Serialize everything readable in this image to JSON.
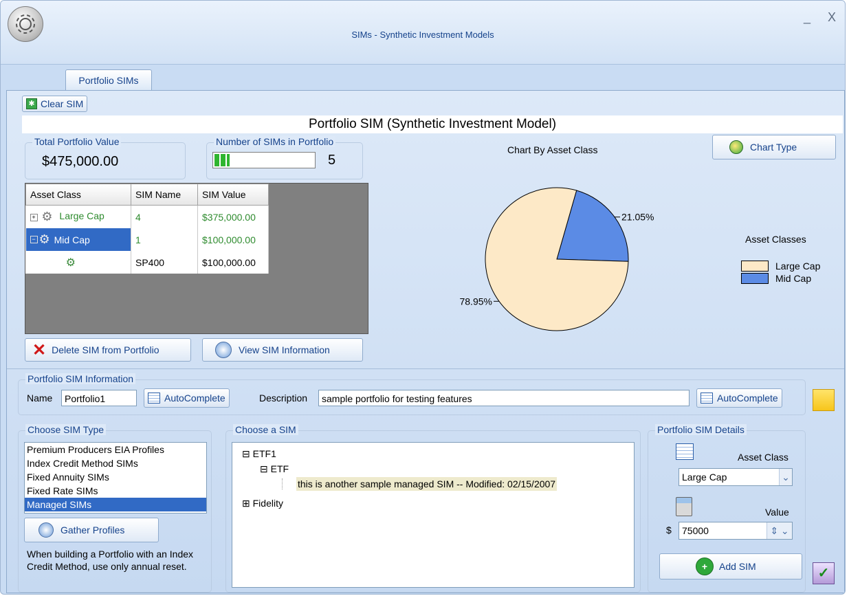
{
  "window": {
    "title": "SIMs - Synthetic Investment Models",
    "minimize_label": "_",
    "close_label": "X"
  },
  "tabs": [
    {
      "label": "Portfolio SIMs"
    }
  ],
  "toolbar": {
    "clear_label": "Clear SIM"
  },
  "banner": {
    "title": "Portfolio SIM (Synthetic Investment Model)"
  },
  "summary": {
    "total_label": "Total Portfolio Value",
    "total_value": "$475,000.00",
    "count_label": "Number of SIMs in Portfolio",
    "count_value": "5",
    "count_progress": 0.15
  },
  "grid": {
    "columns": [
      "Asset Class",
      "SIM Name",
      "SIM Value"
    ],
    "rows": [
      {
        "asset": "Large Cap",
        "name": "4",
        "value": "$375,000.00"
      },
      {
        "asset": "Mid Cap",
        "name": "1",
        "value": "$100,000.00"
      },
      {
        "asset": "",
        "name": "SP400",
        "value": "$100,000.00"
      }
    ],
    "selected_row": 1
  },
  "actions": {
    "delete_label": "Delete SIM from Portfolio",
    "view_label": "View SIM Information",
    "chart_type_label": "Chart Type"
  },
  "chart_data": {
    "type": "pie",
    "title": "Chart By Asset Class",
    "legend_title": "Asset Classes",
    "legend_position": "right",
    "categories": [
      "Large Cap",
      "Mid Cap"
    ],
    "values": [
      78.95,
      21.05
    ],
    "labels": [
      "78.95%",
      "21.05%"
    ],
    "colors": [
      "#fde9c7",
      "#5b8be5"
    ]
  },
  "info": {
    "group_label": "Portfolio SIM Information",
    "name_label": "Name",
    "name_value": "Portfolio1",
    "autocomplete_label": "AutoComplete",
    "description_label": "Description",
    "description_value": "sample portfolio for testing features"
  },
  "sim_type": {
    "group_label": "Choose SIM Type",
    "items": [
      "Premium Producers EIA Profiles",
      "Index Credit Method SIMs",
      "Fixed Annuity SIMs",
      "Fixed Rate SIMs",
      "Managed SIMs"
    ],
    "selected": 4,
    "gather_label": "Gather Profiles",
    "note": "When building a Portfolio with an Index Credit Method, use only annual reset."
  },
  "choose_sim": {
    "group_label": "Choose a SIM",
    "node_etf1": "ETF1",
    "node_etf": "ETF",
    "node_leaf": "this is another sample managed SIM -- Modified: 02/15/2007",
    "node_fidelity": "Fidelity"
  },
  "details": {
    "group_label": "Portfolio SIM Details",
    "asset_class_label": "Asset Class",
    "asset_class_value": "Large Cap",
    "value_label": "Value",
    "currency": "$",
    "value": "75000",
    "add_label": "Add SIM"
  }
}
